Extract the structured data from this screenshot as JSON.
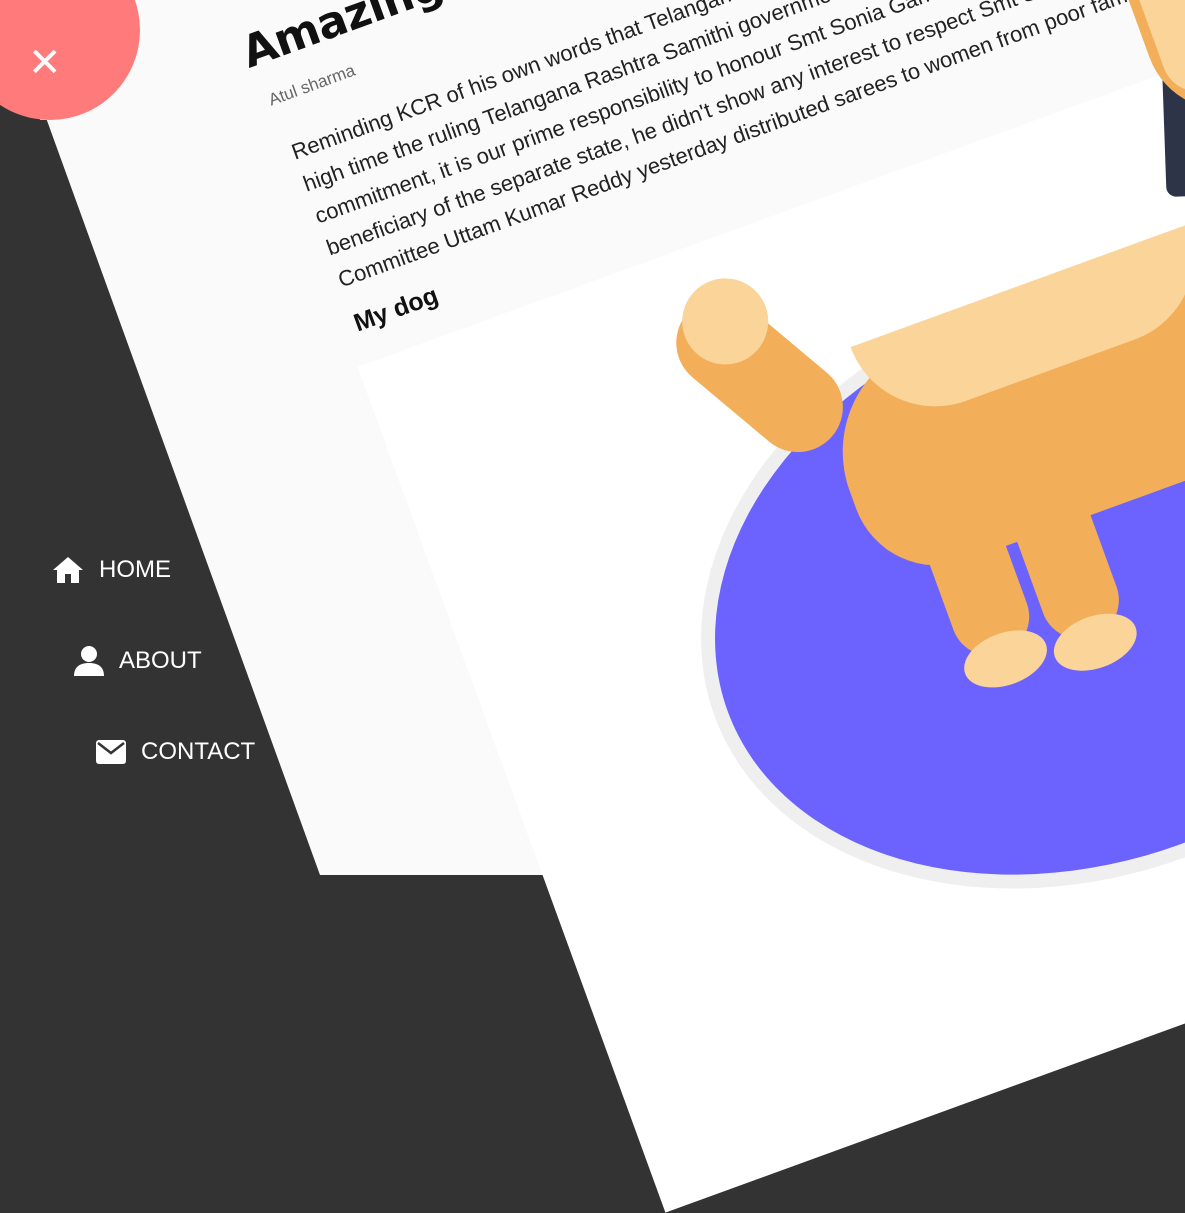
{
  "article": {
    "title": "Amazing article",
    "author": "Atul sharma",
    "paragraph_lines": [
      "Reminding KCR of his own words that Telangana was born because of Smt Sonia Gandhi, it was",
      "high time the ruling Telangana Rashtra Samithi government stuck to the promise made in the",
      "commitment, it is our prime responsibility to honour Smt Sonia Gandhi. Even though he was a",
      "beneficiary of the separate state, he didn't show any interest to respect Smt Sonia Gandhi. Congress",
      "Committee Uttam Kumar Reddy yesterday distributed sarees to women from poor families."
    ],
    "subheading": "My dog"
  },
  "nav": {
    "home_label": "HOME",
    "about_label": "ABOUT",
    "contact_label": "CONTACT"
  },
  "colors": {
    "sidebar": "#333333",
    "close_button": "#ff7b7b",
    "blob": "#6c63ff",
    "dog": "#f3ae59",
    "dog_light": "#fbd49a"
  },
  "icons": {
    "close": "close-icon",
    "home": "home-icon",
    "about": "user-icon",
    "contact": "envelope-icon"
  }
}
